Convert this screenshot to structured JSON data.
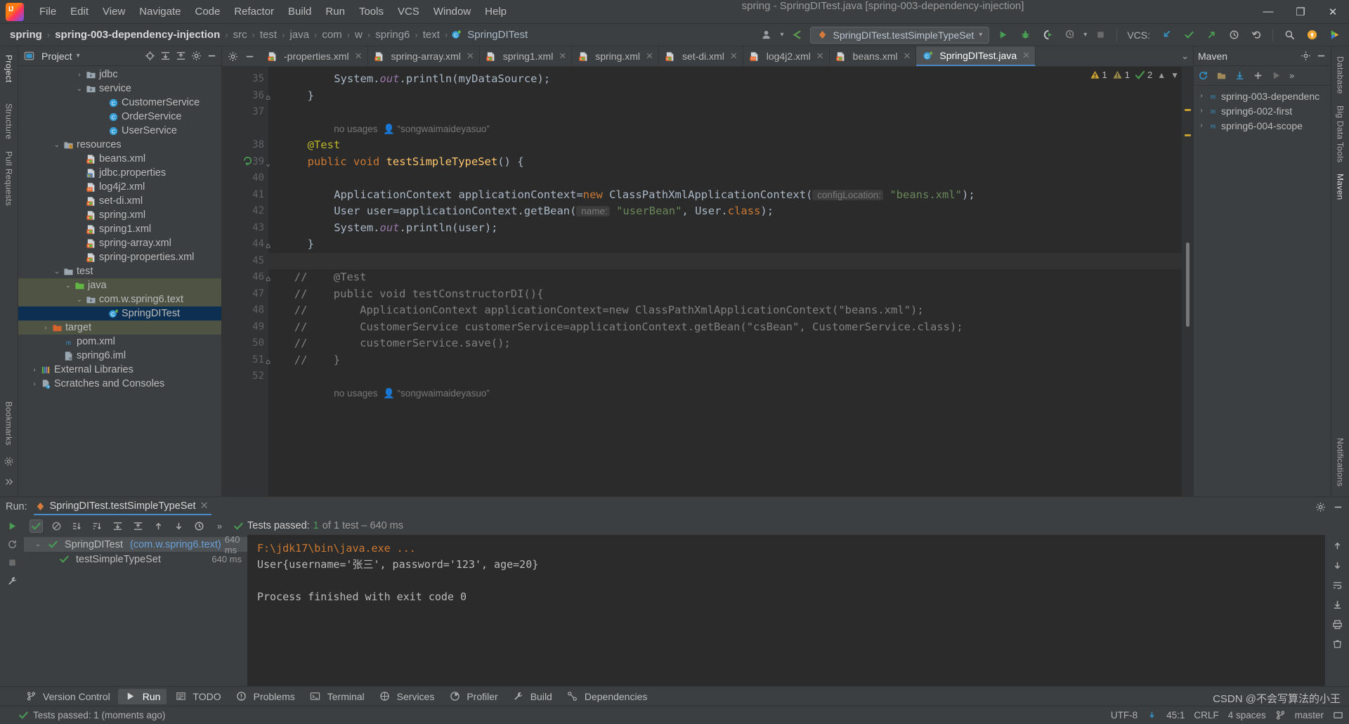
{
  "window": {
    "title": "spring - SpringDITest.java [spring-003-dependency-injection]",
    "minimize": "—",
    "maximize": "❐",
    "close": "✕"
  },
  "menu": {
    "items": [
      "File",
      "Edit",
      "View",
      "Navigate",
      "Code",
      "Refactor",
      "Build",
      "Run",
      "Tools",
      "VCS",
      "Window",
      "Help"
    ]
  },
  "breadcrumb": {
    "items": [
      "spring",
      "spring-003-dependency-injection",
      "src",
      "test",
      "java",
      "com",
      "w",
      "spring6",
      "text",
      "SpringDITest"
    ],
    "separator": "›"
  },
  "toolbar": {
    "run_config": "SpringDITest.testSimpleTypeSet",
    "dropdown_caret": "▾",
    "vcs_label": "VCS:"
  },
  "project_panel": {
    "title": "Project",
    "tree": [
      {
        "indent": 5,
        "chev": "›",
        "icon": "folder-pkg",
        "label": "jdbc"
      },
      {
        "indent": 5,
        "chev": "⌄",
        "icon": "folder-pkg",
        "label": "service"
      },
      {
        "indent": 7,
        "chev": "",
        "icon": "class",
        "label": "CustomerService"
      },
      {
        "indent": 7,
        "chev": "",
        "icon": "class",
        "label": "OrderService"
      },
      {
        "indent": 7,
        "chev": "",
        "icon": "class",
        "label": "UserService"
      },
      {
        "indent": 3,
        "chev": "⌄",
        "icon": "folder-res",
        "label": "resources"
      },
      {
        "indent": 5,
        "chev": "",
        "icon": "spring-xml",
        "label": "beans.xml"
      },
      {
        "indent": 5,
        "chev": "",
        "icon": "properties",
        "label": "jdbc.properties"
      },
      {
        "indent": 5,
        "chev": "",
        "icon": "xml",
        "label": "log4j2.xml"
      },
      {
        "indent": 5,
        "chev": "",
        "icon": "spring-xml",
        "label": "set-di.xml"
      },
      {
        "indent": 5,
        "chev": "",
        "icon": "spring-xml",
        "label": "spring.xml"
      },
      {
        "indent": 5,
        "chev": "",
        "icon": "spring-xml",
        "label": "spring1.xml"
      },
      {
        "indent": 5,
        "chev": "",
        "icon": "spring-xml",
        "label": "spring-array.xml"
      },
      {
        "indent": 5,
        "chev": "",
        "icon": "spring-xml",
        "label": "spring-properties.xml"
      },
      {
        "indent": 3,
        "chev": "⌄",
        "icon": "folder",
        "label": "test"
      },
      {
        "indent": 4,
        "chev": "⌄",
        "icon": "folder-src",
        "label": "java",
        "state": "ctx"
      },
      {
        "indent": 5,
        "chev": "⌄",
        "icon": "folder-pkg",
        "label": "com.w.spring6.text",
        "state": "ctx"
      },
      {
        "indent": 7,
        "chev": "",
        "icon": "test-class",
        "label": "SpringDITest",
        "state": "sel"
      },
      {
        "indent": 2,
        "chev": "›",
        "icon": "folder-target",
        "label": "target",
        "state": "ctx"
      },
      {
        "indent": 3,
        "chev": "",
        "icon": "maven",
        "label": "pom.xml"
      },
      {
        "indent": 3,
        "chev": "",
        "icon": "iml",
        "label": "spring6.iml"
      },
      {
        "indent": 1,
        "chev": "›",
        "icon": "libs",
        "label": "External Libraries"
      },
      {
        "indent": 1,
        "chev": "›",
        "icon": "scratch",
        "label": "Scratches and Consoles"
      }
    ]
  },
  "left_rail": {
    "items": [
      "Project",
      "Structure",
      "Pull Requests",
      "Bookmarks"
    ]
  },
  "right_rail": {
    "items": [
      "Database",
      "Big Data Tools",
      "Maven",
      "Notifications"
    ]
  },
  "editor_tabs": {
    "tabs": [
      {
        "label": "-properties.xml",
        "icon": "spring-xml",
        "active": false
      },
      {
        "label": "spring-array.xml",
        "icon": "spring-xml",
        "active": false
      },
      {
        "label": "spring1.xml",
        "icon": "spring-xml",
        "active": false
      },
      {
        "label": "spring.xml",
        "icon": "spring-xml",
        "active": false
      },
      {
        "label": "set-di.xml",
        "icon": "spring-xml",
        "active": false
      },
      {
        "label": "log4j2.xml",
        "icon": "xml",
        "active": false
      },
      {
        "label": "beans.xml",
        "icon": "spring-xml",
        "active": false
      },
      {
        "label": "SpringDITest.java",
        "icon": "test-class",
        "active": true
      }
    ],
    "close_glyph": "✕",
    "overflow_glyph": "⌄"
  },
  "editor_status": {
    "warnings": "1",
    "weak_warnings": "1",
    "checks": "2"
  },
  "code": {
    "first_line": 35,
    "lines": [
      {
        "n": "35",
        "fold": "",
        "indent": 8,
        "segs": [
          {
            "t": "System.",
            "c": "cls"
          },
          {
            "t": "out",
            "c": "fld"
          },
          {
            "t": ".println(myDataSource);",
            "c": "cls"
          }
        ]
      },
      {
        "n": "36",
        "fold": "⌂",
        "indent": 4,
        "segs": [
          {
            "t": "}",
            "c": "cls"
          }
        ]
      },
      {
        "n": "37",
        "fold": "",
        "indent": 0,
        "segs": []
      },
      {
        "n": "",
        "fold": "",
        "indent": 8,
        "segs": [
          {
            "t": "no usages",
            "c": "inlay"
          },
          {
            "t": "  👤 “songwaimaideyasuo”",
            "c": "inlay"
          }
        ]
      },
      {
        "n": "38",
        "fold": "",
        "indent": 4,
        "segs": [
          {
            "t": "@Test",
            "c": "ann"
          }
        ]
      },
      {
        "n": "39",
        "fold": "⌄",
        "indent": 4,
        "gmark": "run",
        "segs": [
          {
            "t": "public void ",
            "c": "kw"
          },
          {
            "t": "testSimpleTypeSet",
            "c": "fn"
          },
          {
            "t": "() {",
            "c": "cls"
          }
        ]
      },
      {
        "n": "40",
        "fold": "",
        "indent": 0,
        "segs": []
      },
      {
        "n": "41",
        "fold": "",
        "indent": 8,
        "segs": [
          {
            "t": "ApplicationContext applicationContext=",
            "c": "cls"
          },
          {
            "t": "new",
            "c": "kw"
          },
          {
            "t": " ClassPathXmlApplicationContext(",
            "c": "cls"
          },
          {
            "t": " configLocation:",
            "c": "hint"
          },
          {
            "t": " ",
            "c": "cls"
          },
          {
            "t": "\"beans.xml\"",
            "c": "str"
          },
          {
            "t": ");",
            "c": "cls"
          }
        ]
      },
      {
        "n": "42",
        "fold": "",
        "indent": 8,
        "segs": [
          {
            "t": "User user=applicationContext.getBean(",
            "c": "cls"
          },
          {
            "t": " name:",
            "c": "hint"
          },
          {
            "t": " ",
            "c": "cls"
          },
          {
            "t": "\"userBean\"",
            "c": "str"
          },
          {
            "t": ", User.",
            "c": "cls"
          },
          {
            "t": "class",
            "c": "kw"
          },
          {
            "t": ");",
            "c": "cls"
          }
        ]
      },
      {
        "n": "43",
        "fold": "",
        "indent": 8,
        "segs": [
          {
            "t": "System.",
            "c": "cls"
          },
          {
            "t": "out",
            "c": "fld"
          },
          {
            "t": ".println(user);",
            "c": "cls"
          }
        ]
      },
      {
        "n": "44",
        "fold": "⌂",
        "indent": 4,
        "segs": [
          {
            "t": "}",
            "c": "cls"
          }
        ]
      },
      {
        "n": "45",
        "fold": "",
        "indent": 0,
        "hl": true,
        "segs": []
      },
      {
        "n": "46",
        "fold": "⌂",
        "indent": 2,
        "segs": [
          {
            "t": "//    @Test",
            "c": "cmt"
          }
        ]
      },
      {
        "n": "47",
        "fold": "",
        "indent": 2,
        "segs": [
          {
            "t": "//    public void testConstructorDI(){",
            "c": "cmt"
          }
        ]
      },
      {
        "n": "48",
        "fold": "",
        "indent": 2,
        "segs": [
          {
            "t": "//        ApplicationContext applicationContext=new ClassPathXmlApplicationContext(\"beans.xml\");",
            "c": "cmt"
          }
        ]
      },
      {
        "n": "49",
        "fold": "",
        "indent": 2,
        "segs": [
          {
            "t": "//        CustomerService customerService=applicationContext.getBean(\"csBean\", CustomerService.class);",
            "c": "cmt"
          }
        ]
      },
      {
        "n": "50",
        "fold": "",
        "indent": 2,
        "segs": [
          {
            "t": "//        customerService.save();",
            "c": "cmt"
          }
        ]
      },
      {
        "n": "51",
        "fold": "⌂",
        "indent": 2,
        "segs": [
          {
            "t": "//    }",
            "c": "cmt"
          }
        ]
      },
      {
        "n": "52",
        "fold": "",
        "indent": 0,
        "segs": []
      },
      {
        "n": "",
        "fold": "",
        "indent": 8,
        "segs": [
          {
            "t": "no usages",
            "c": "inlay"
          },
          {
            "t": "  👤 “songwaimaideyasuo”",
            "c": "inlay"
          }
        ]
      }
    ]
  },
  "maven_panel": {
    "title": "Maven",
    "projects": [
      {
        "chev": "›",
        "label": "spring-003-dependenc"
      },
      {
        "chev": "›",
        "label": "spring6-002-first"
      },
      {
        "chev": "›",
        "label": "spring6-004-scope"
      }
    ]
  },
  "run_panel": {
    "label": "Run:",
    "tab": "SpringDITest.testSimpleTypeSet",
    "close_glyph": "✕",
    "overflow_glyph": "»",
    "status_prefix": "Tests passed: ",
    "status_count": "1",
    "status_suffix": " of 1 test – 640 ms",
    "tree": [
      {
        "indent": 0,
        "chev": "⌄",
        "icon": "pass",
        "label": "SpringDITest",
        "sub": "(com.w.spring6.text)",
        "time": "640 ms",
        "sel": true
      },
      {
        "indent": 1,
        "chev": "",
        "icon": "pass",
        "label": "testSimpleTypeSet",
        "sub": "",
        "time": "640 ms",
        "sel": false
      }
    ],
    "console": [
      {
        "text": "F:\\jdk17\\bin\\java.exe ...",
        "link": true
      },
      {
        "text": "User{username='张三', password='123', age=20}",
        "link": false
      },
      {
        "text": "",
        "link": false
      },
      {
        "text": "Process finished with exit code 0",
        "link": false
      }
    ]
  },
  "bottom_bar": {
    "items": [
      {
        "label": "Version Control",
        "icon": "vcs",
        "active": false
      },
      {
        "label": "Run",
        "icon": "run",
        "active": true
      },
      {
        "label": "TODO",
        "icon": "todo",
        "active": false
      },
      {
        "label": "Problems",
        "icon": "problems",
        "active": false
      },
      {
        "label": "Terminal",
        "icon": "terminal",
        "active": false
      },
      {
        "label": "Services",
        "icon": "services",
        "active": false
      },
      {
        "label": "Profiler",
        "icon": "profiler",
        "active": false
      },
      {
        "label": "Build",
        "icon": "build",
        "active": false
      },
      {
        "label": "Dependencies",
        "icon": "dependencies",
        "active": false
      }
    ]
  },
  "status_bar": {
    "message": "Tests passed: 1 (moments ago)",
    "encoding": "UTF-8",
    "caret": "45:1",
    "line_sep": "CRLF",
    "indent": "4 spaces",
    "branch": "master",
    "watermark": "CSDN @不会写算法的小王"
  },
  "colors": {
    "accent": "#4a88c7",
    "selection": "#0d2f52",
    "context": "#4e5344",
    "pass": "#499c54",
    "keyword": "#cc7832",
    "string": "#6a8759",
    "annotation": "#bbb529",
    "method": "#ffc66d",
    "comment": "#808080"
  }
}
